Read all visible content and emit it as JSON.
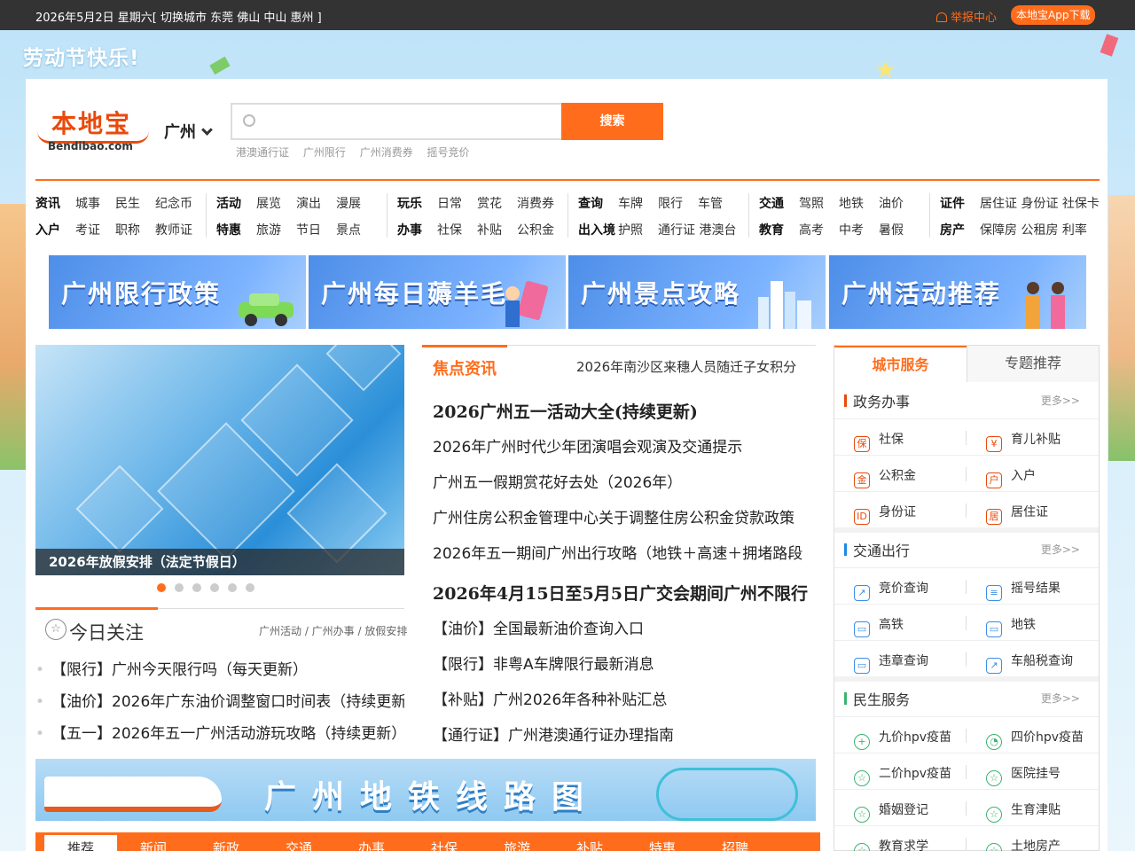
{
  "topbar": {
    "date_text": "2026年5月2日 星期六[ 切换城市 东莞 佛山 中山 惠州 ]",
    "report": "举报中心",
    "app_download": "本地宝App下载"
  },
  "holiday_banner": "劳动节快乐!",
  "logo": {
    "cn": "本地宝",
    "en": "Bendibao.com"
  },
  "city": "广州",
  "search": {
    "placeholder": "",
    "button": "搜索",
    "hot": [
      "港澳通行证",
      "广州限行",
      "广州消费券",
      "摇号竞价"
    ]
  },
  "nav": {
    "g1": {
      "r1": [
        "资讯",
        "城事",
        "民生",
        "纪念币"
      ],
      "r2": [
        "入户",
        "考证",
        "职称",
        "教师证"
      ]
    },
    "g2": {
      "r1": [
        "活动",
        "展览",
        "演出",
        "漫展"
      ],
      "r2": [
        "特惠",
        "旅游",
        "节日",
        "景点"
      ]
    },
    "g3": {
      "r1": [
        "玩乐",
        "日常",
        "赏花",
        "消费券"
      ],
      "r2": [
        "办事",
        "社保",
        "补贴",
        "公积金"
      ]
    },
    "g4": {
      "r1": [
        "查询",
        "车牌",
        "限行",
        "车管"
      ],
      "r2": [
        "出入境",
        "护照",
        "通行证 港澳台"
      ]
    },
    "g5": {
      "r1": [
        "交通",
        "驾照",
        "地铁",
        "油价"
      ],
      "r2": [
        "教育",
        "高考",
        "中考",
        "暑假"
      ]
    },
    "g6": {
      "r1": [
        "证件",
        "居住证 身份证 社保卡"
      ],
      "r2": [
        "房产",
        "保障房 公租房 利率"
      ]
    }
  },
  "banners": [
    "广州限行政策",
    "广州每日薅羊毛",
    "广州景点攻略",
    "广州活动推荐"
  ],
  "slider": {
    "caption": "2026年放假安排（法定节假日）"
  },
  "today": {
    "title": "今日关注",
    "links": "广州活动 / 广州办事 / 放假安排",
    "items": [
      "【限行】广州今天限行吗（每天更新）",
      "【油价】2026年广东油价调整窗口时间表（持续更新）",
      "【五一】2026年五一广州活动游玩攻略（持续更新）"
    ]
  },
  "focus": {
    "title": "焦点资讯",
    "sub": "2026年南沙区来穗人员随迁子女积分",
    "items": [
      "2026广州五一活动大全(持续更新)",
      "2026年广州时代少年团演唱会观演及交通提示",
      "广州五一假期赏花好去处（2026年）",
      "广州住房公积金管理中心关于调整住房公积金贷款政策",
      "2026年五一期间广州出行攻略（地铁＋高速＋拥堵路段",
      "2026年4月15日至5月5日广交会期间广州不限行",
      "【油价】全国最新油价查询入口",
      "【限行】非粤A车牌限行最新消息",
      "【补贴】广州2026年各种补贴汇总",
      "【通行证】广州港澳通行证办理指南"
    ]
  },
  "metro_banner": "广州地铁线路图",
  "bottom_tabs": [
    "推荐",
    "新闻",
    "新政",
    "交通",
    "办事",
    "社保",
    "旅游",
    "补贴",
    "特惠",
    "招聘"
  ],
  "services": {
    "tab_active": "城市服务",
    "tab_other": "专题推荐",
    "more": "更多>>",
    "gov": {
      "title": "政务办事",
      "items": [
        "社保",
        "育儿补贴",
        "公积金",
        "入户",
        "身份证",
        "居住证"
      ]
    },
    "traffic": {
      "title": "交通出行",
      "items": [
        "竞价查询",
        "摇号结果",
        "高铁",
        "地铁",
        "违章查询",
        "车船税查询"
      ]
    },
    "life": {
      "title": "民生服务",
      "items": [
        "九价hpv疫苗",
        "四价hpv疫苗",
        "二价hpv疫苗",
        "医院挂号",
        "婚姻登记",
        "生育津贴",
        "教育求学",
        "土地房产"
      ]
    }
  },
  "colors": {
    "accent": "#ff6d1c",
    "topbar": "#333333"
  }
}
